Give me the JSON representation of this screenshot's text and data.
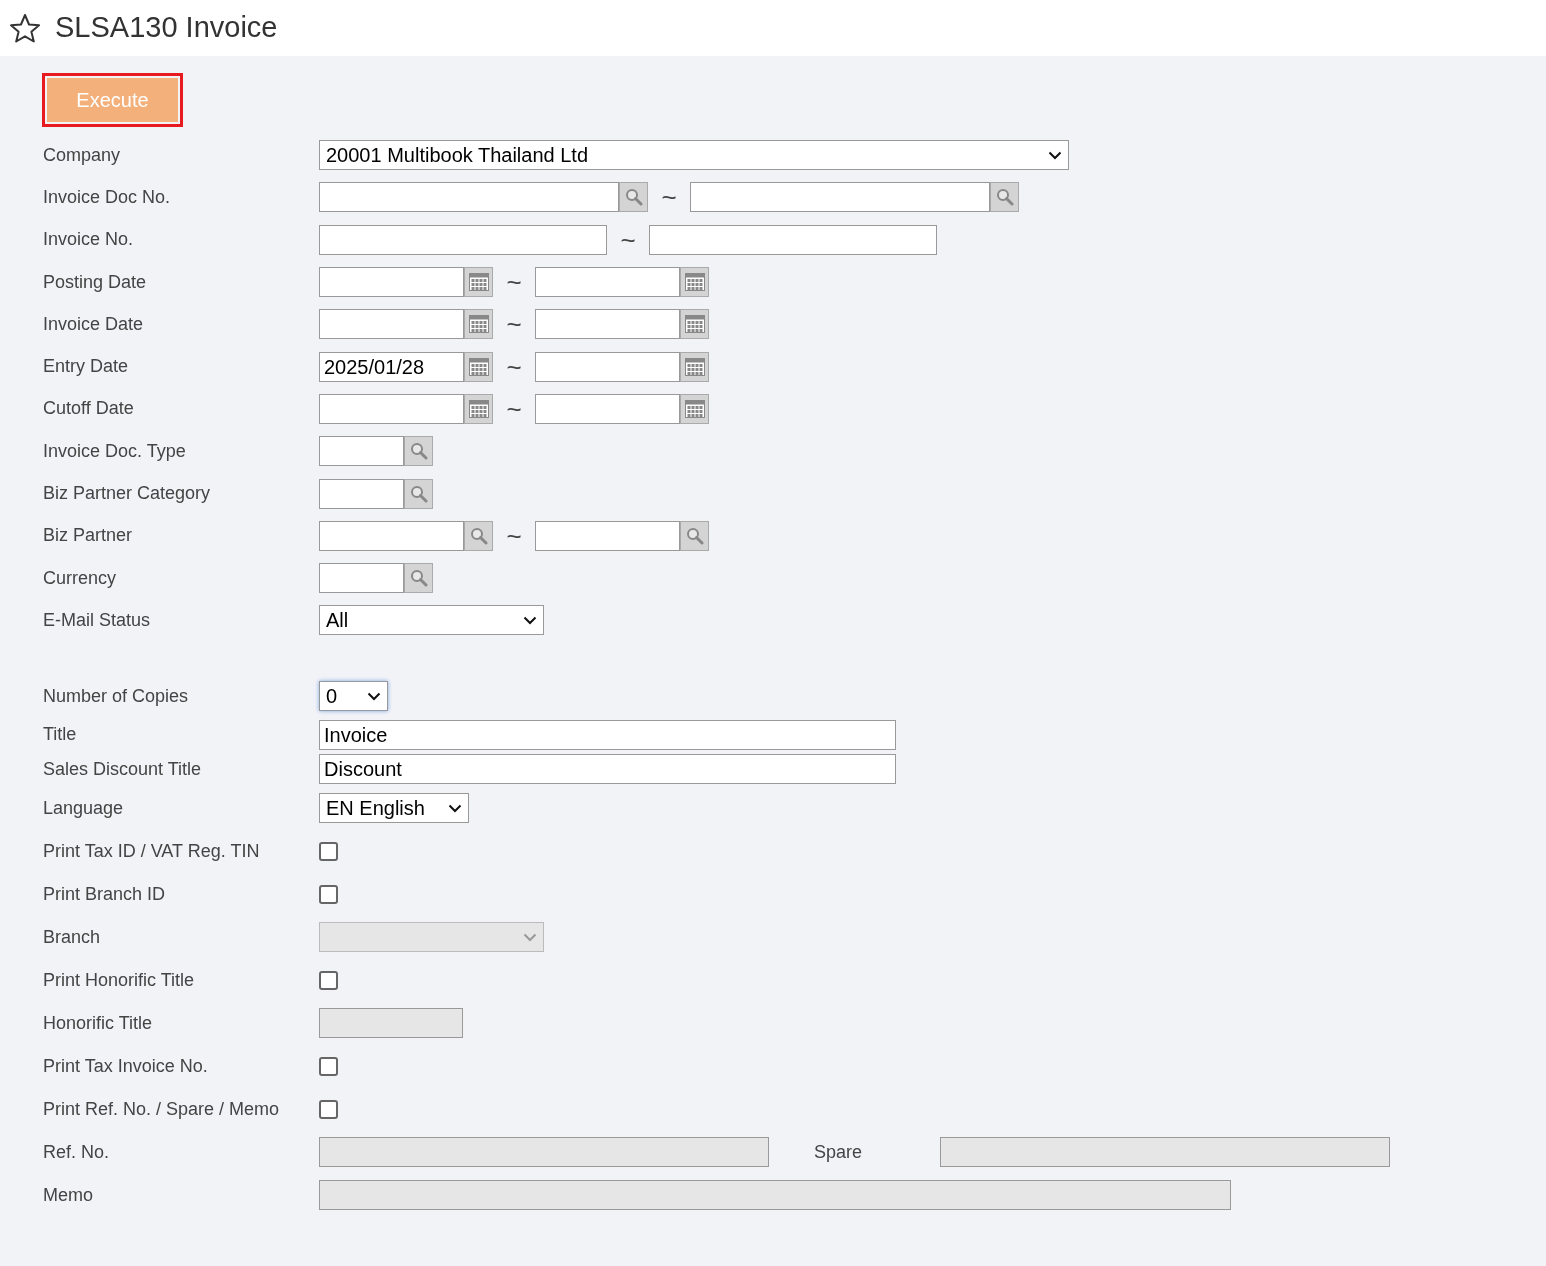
{
  "page": {
    "title": "SLSA130 Invoice"
  },
  "execute_button": {
    "label": "Execute"
  },
  "criteria": [
    {
      "kind": "select",
      "label": "Company",
      "value": "20001 Multibook Thailand Ltd"
    },
    {
      "kind": "lookuprange",
      "label": "Invoice Doc No.",
      "separator": "~"
    },
    {
      "kind": "textrange",
      "label": "Invoice No.",
      "separator": "~"
    },
    {
      "kind": "daterange",
      "label": "Posting Date",
      "separator": "~"
    },
    {
      "kind": "daterange",
      "label": "Invoice Date",
      "separator": "~"
    },
    {
      "kind": "daterange",
      "label": "Entry Date",
      "from": "2025/01/28",
      "separator": "~"
    },
    {
      "kind": "daterange",
      "label": "Cutoff Date",
      "separator": "~"
    },
    {
      "kind": "lookup",
      "label": "Invoice Doc. Type"
    },
    {
      "kind": "lookup",
      "label": "Biz Partner Category"
    },
    {
      "kind": "lookuprange",
      "label": "Biz Partner",
      "separator": "~"
    },
    {
      "kind": "lookup",
      "label": "Currency"
    },
    {
      "kind": "select",
      "label": "E-Mail Status",
      "value": "All"
    }
  ],
  "print_options": [
    {
      "kind": "select",
      "label": "Number of Copies",
      "value": "0",
      "focused": true
    },
    {
      "kind": "text",
      "label": "Title",
      "value": "Invoice",
      "disabled": false
    },
    {
      "kind": "text",
      "label": "Sales Discount Title",
      "value": "Discount",
      "disabled": false
    },
    {
      "kind": "select",
      "label": "Language",
      "value": "EN English"
    },
    {
      "kind": "checkbox",
      "label": "Print Tax ID / VAT Reg. TIN",
      "checked": false
    },
    {
      "kind": "checkbox",
      "label": "Print Branch ID",
      "checked": false
    },
    {
      "kind": "select",
      "label": "Branch",
      "disabled": true
    },
    {
      "kind": "checkbox",
      "label": "Print Honorific Title",
      "checked": false
    },
    {
      "kind": "text",
      "label": "Honorific Title",
      "disabled": true
    },
    {
      "kind": "checkbox",
      "label": "Print Tax Invoice No.",
      "checked": false
    },
    {
      "kind": "checkbox",
      "label": "Print Ref. No. / Spare / Memo",
      "checked": false
    },
    {
      "kind": "pair",
      "label": "Ref. No.",
      "second_label": "Spare",
      "disabled": true
    },
    {
      "kind": "text",
      "label": "Memo",
      "disabled": true
    }
  ]
}
